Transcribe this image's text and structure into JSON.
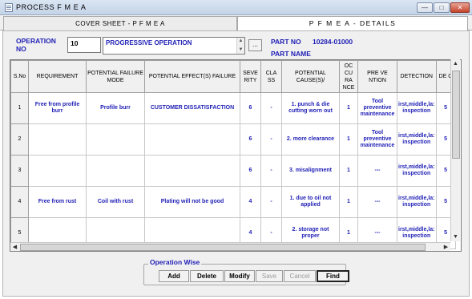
{
  "window": {
    "title": "PROCESS  F M E A"
  },
  "tabs": [
    {
      "label": "COVER SHEET   -   P  F  M  E   A"
    },
    {
      "label": "P  F  M  E  A  - DETAILS"
    }
  ],
  "header": {
    "operation_label": "OPERATION NO",
    "operation_no": "10",
    "operation_desc": "PROGRESSIVE OPERATION",
    "browse_label": "...",
    "part_no_label": "PART NO",
    "part_no_value": "10284-01000",
    "part_name_label": "PART NAME"
  },
  "grid": {
    "columns": [
      "S.No",
      "REQUIREMENT",
      "POTENTIAL FAILURE MODE",
      "POTENTIAL EFFECT(S) FAILURE",
      "SEVE RITY",
      "CLA SS",
      "POTENTIAL CAUSE(S)/",
      "OC CU RA NCE",
      "PRE VE NTION",
      "DETECTION",
      "DE C"
    ],
    "rows": [
      [
        "1",
        "Free from profile burr",
        "Profile burr",
        "CUSTOMER DISSATISFACTION",
        "6",
        "-",
        "1. punch & die cutting worn out",
        "1",
        "Tool preventive maintenance",
        "irst,middle,la: inspection",
        "5"
      ],
      [
        "2",
        "",
        "",
        "",
        "6",
        "-",
        "2. more clearance",
        "1",
        "Tool preventive maintenance",
        "irst,middle,la: inspection",
        "5"
      ],
      [
        "3",
        "",
        "",
        "",
        "6",
        "-",
        "3. misalignment",
        "1",
        "---",
        "irst,middle,la: inspection",
        "5"
      ],
      [
        "4",
        "Free from rust",
        "Coil with rust",
        "Plating will not be good",
        "4",
        "-",
        "1. due to oil not applied",
        "1",
        "---",
        "irst,middle,la: inspection",
        "5"
      ],
      [
        "5",
        "",
        "",
        "",
        "4",
        "-",
        "2. storage not proper",
        "1",
        "---",
        "irst,middle,la: inspection",
        "5"
      ]
    ]
  },
  "operation_wise": {
    "legend": "Operation Wise",
    "add": "Add",
    "delete": "Delete",
    "modify": "Modify",
    "save": "Save",
    "cancel": "Cancel",
    "find": "Find"
  },
  "colors": {
    "accent_text": "#1f1fb6",
    "panel_bg": "#f0f0f0"
  }
}
